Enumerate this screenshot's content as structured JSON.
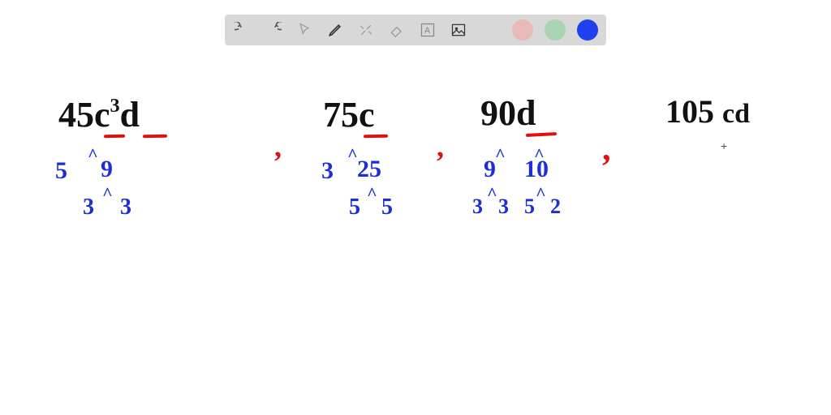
{
  "toolbar": {
    "icons": {
      "undo": "undo",
      "redo": "redo",
      "pointer": "pointer",
      "pen": "pen",
      "tools": "tools",
      "eraser": "eraser",
      "text": "text",
      "image": "image"
    },
    "colors": {
      "gray": "#9a9a9a",
      "pink": "#e8b9b6",
      "green": "#a9d3b1",
      "blue": "#2040f0"
    }
  },
  "terms": {
    "t1": {
      "coef": "45",
      "var1": "c",
      "exp": "3",
      "var2": "d"
    },
    "t2": {
      "coef": "75",
      "var": "c"
    },
    "t3": {
      "coef": "90",
      "var": "d"
    },
    "t4": {
      "coef": "105",
      "vars": "cd"
    }
  },
  "trees": {
    "t1": {
      "l": "5",
      "r": "9",
      "rl": "3",
      "rr": "3"
    },
    "t2": {
      "l": "3",
      "r": "25",
      "rl": "5",
      "rr": "5"
    },
    "t3": {
      "l": "9",
      "r": "10",
      "ll": "3",
      "lr": "3",
      "rl": "5",
      "rr": "2"
    }
  },
  "carets": {
    "up": "^"
  },
  "separators": {
    "comma": ","
  },
  "marks": {
    "cross": "+"
  }
}
